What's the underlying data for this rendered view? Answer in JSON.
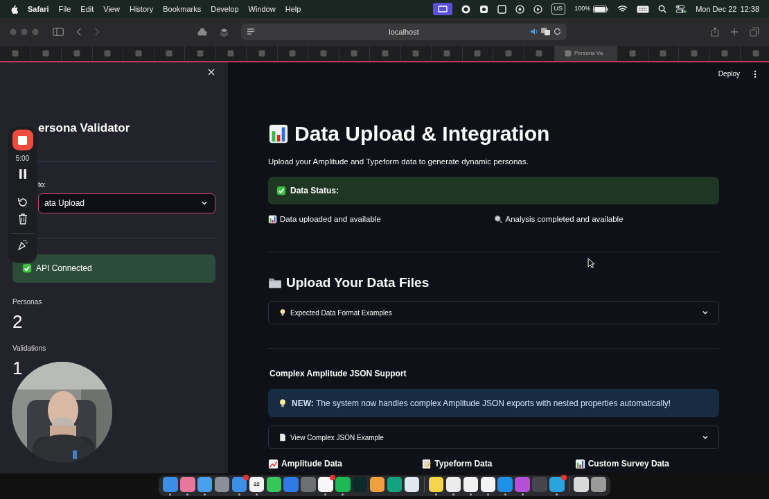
{
  "menu_bar": {
    "app": "Safari",
    "menus": [
      "File",
      "Edit",
      "View",
      "History",
      "Bookmarks",
      "Develop",
      "Window",
      "Help"
    ],
    "input_source": "US",
    "battery": "100%",
    "date": "Mon Dec 22",
    "time": "12:38"
  },
  "browser": {
    "address": "localhost",
    "tabs": [
      {
        "selected": false
      },
      {
        "selected": false
      },
      {
        "selected": false
      },
      {
        "selected": false
      },
      {
        "selected": false
      },
      {
        "selected": false
      },
      {
        "selected": false
      },
      {
        "selected": false
      },
      {
        "selected": false
      },
      {
        "selected": false
      },
      {
        "selected": false
      },
      {
        "selected": false
      },
      {
        "selected": false
      },
      {
        "selected": false
      },
      {
        "selected": false
      },
      {
        "selected": false
      },
      {
        "selected": false
      },
      {
        "selected": false
      },
      {
        "selected": true,
        "title": "Persona Va"
      },
      {
        "selected": false
      },
      {
        "selected": false
      },
      {
        "selected": false
      },
      {
        "selected": false
      },
      {
        "selected": false
      }
    ]
  },
  "sidebar": {
    "title": "ersona Validator",
    "nav_label": "to:",
    "nav_select": "ata Upload",
    "status": {
      "kind": "success",
      "text": "API Connected"
    },
    "metrics": [
      {
        "label": "Personas",
        "value": "2"
      },
      {
        "label": "Validations",
        "value": "1"
      }
    ]
  },
  "recorder": {
    "timer": "5:00"
  },
  "main": {
    "deploy": "Deploy",
    "title": "Data Upload & Integration",
    "caption": "Upload your Amplitude and Typeform data to generate dynamic personas.",
    "data_status": {
      "kind": "success",
      "text": "Data Status:"
    },
    "status_items": [
      "Data uploaded and available",
      "Analysis completed and available"
    ],
    "section_title": "Upload Your Data Files",
    "expanders": [
      {
        "label": "Expected Data Format Examples",
        "expanded": false
      }
    ],
    "subsection_title": "Complex Amplitude JSON Support",
    "notice": {
      "kind": "info",
      "text": "**NEW:** The system now handles complex Amplitude JSON exports with nested properties automatically!"
    },
    "example_expander": {
      "label": "View Complex JSON Example",
      "expanded": false
    },
    "column_headers": [
      "Amplitude Data",
      "Typeform Data",
      "Custom Survey Data"
    ]
  },
  "dock": {
    "apps": [
      {
        "color": "#3a8ee8",
        "running": true,
        "badge": false
      },
      {
        "color": "#e8789a",
        "running": true,
        "badge": false
      },
      {
        "color": "#4a9ff0",
        "running": true,
        "badge": false
      },
      {
        "color": "#8a8f99",
        "running": false,
        "badge": false
      },
      {
        "color": "#3d8fe6",
        "running": true,
        "badge": true
      },
      {
        "color": "#f4f4f4",
        "running": true,
        "badge": false,
        "label": "22"
      },
      {
        "color": "#34c759",
        "running": false,
        "badge": false
      },
      {
        "color": "#2f7ae5",
        "running": false,
        "badge": false
      },
      {
        "color": "#6d6f73",
        "running": false,
        "badge": false
      },
      {
        "color": "#f7f7f7",
        "running": true,
        "badge": true
      },
      {
        "color": "#1db954",
        "running": true,
        "badge": false
      },
      {
        "color": "#0c2a2c",
        "running": false,
        "badge": false
      },
      {
        "color": "#f2a03b",
        "running": false,
        "badge": false
      },
      {
        "color": "#15a37f",
        "running": false,
        "badge": false
      },
      {
        "color": "#dfe8ee",
        "running": false,
        "badge": false
      },
      {
        "color": "#f7d54a",
        "running": true,
        "badge": false
      },
      {
        "color": "#ececec",
        "running": true,
        "badge": false
      },
      {
        "color": "#f1f1f1",
        "running": true,
        "badge": false
      },
      {
        "color": "#f3f3f3",
        "running": true,
        "badge": false
      },
      {
        "color": "#1d91e6",
        "running": true,
        "badge": false
      },
      {
        "color": "#b44fd8",
        "running": true,
        "badge": false
      },
      {
        "color": "#45454a",
        "running": false,
        "badge": false
      },
      {
        "color": "#2aa3de",
        "running": true,
        "badge": true
      },
      {
        "color": "#d9d9d9",
        "running": false,
        "badge": false
      },
      {
        "color": "#9a9a9a",
        "running": false,
        "badge": false
      }
    ]
  }
}
